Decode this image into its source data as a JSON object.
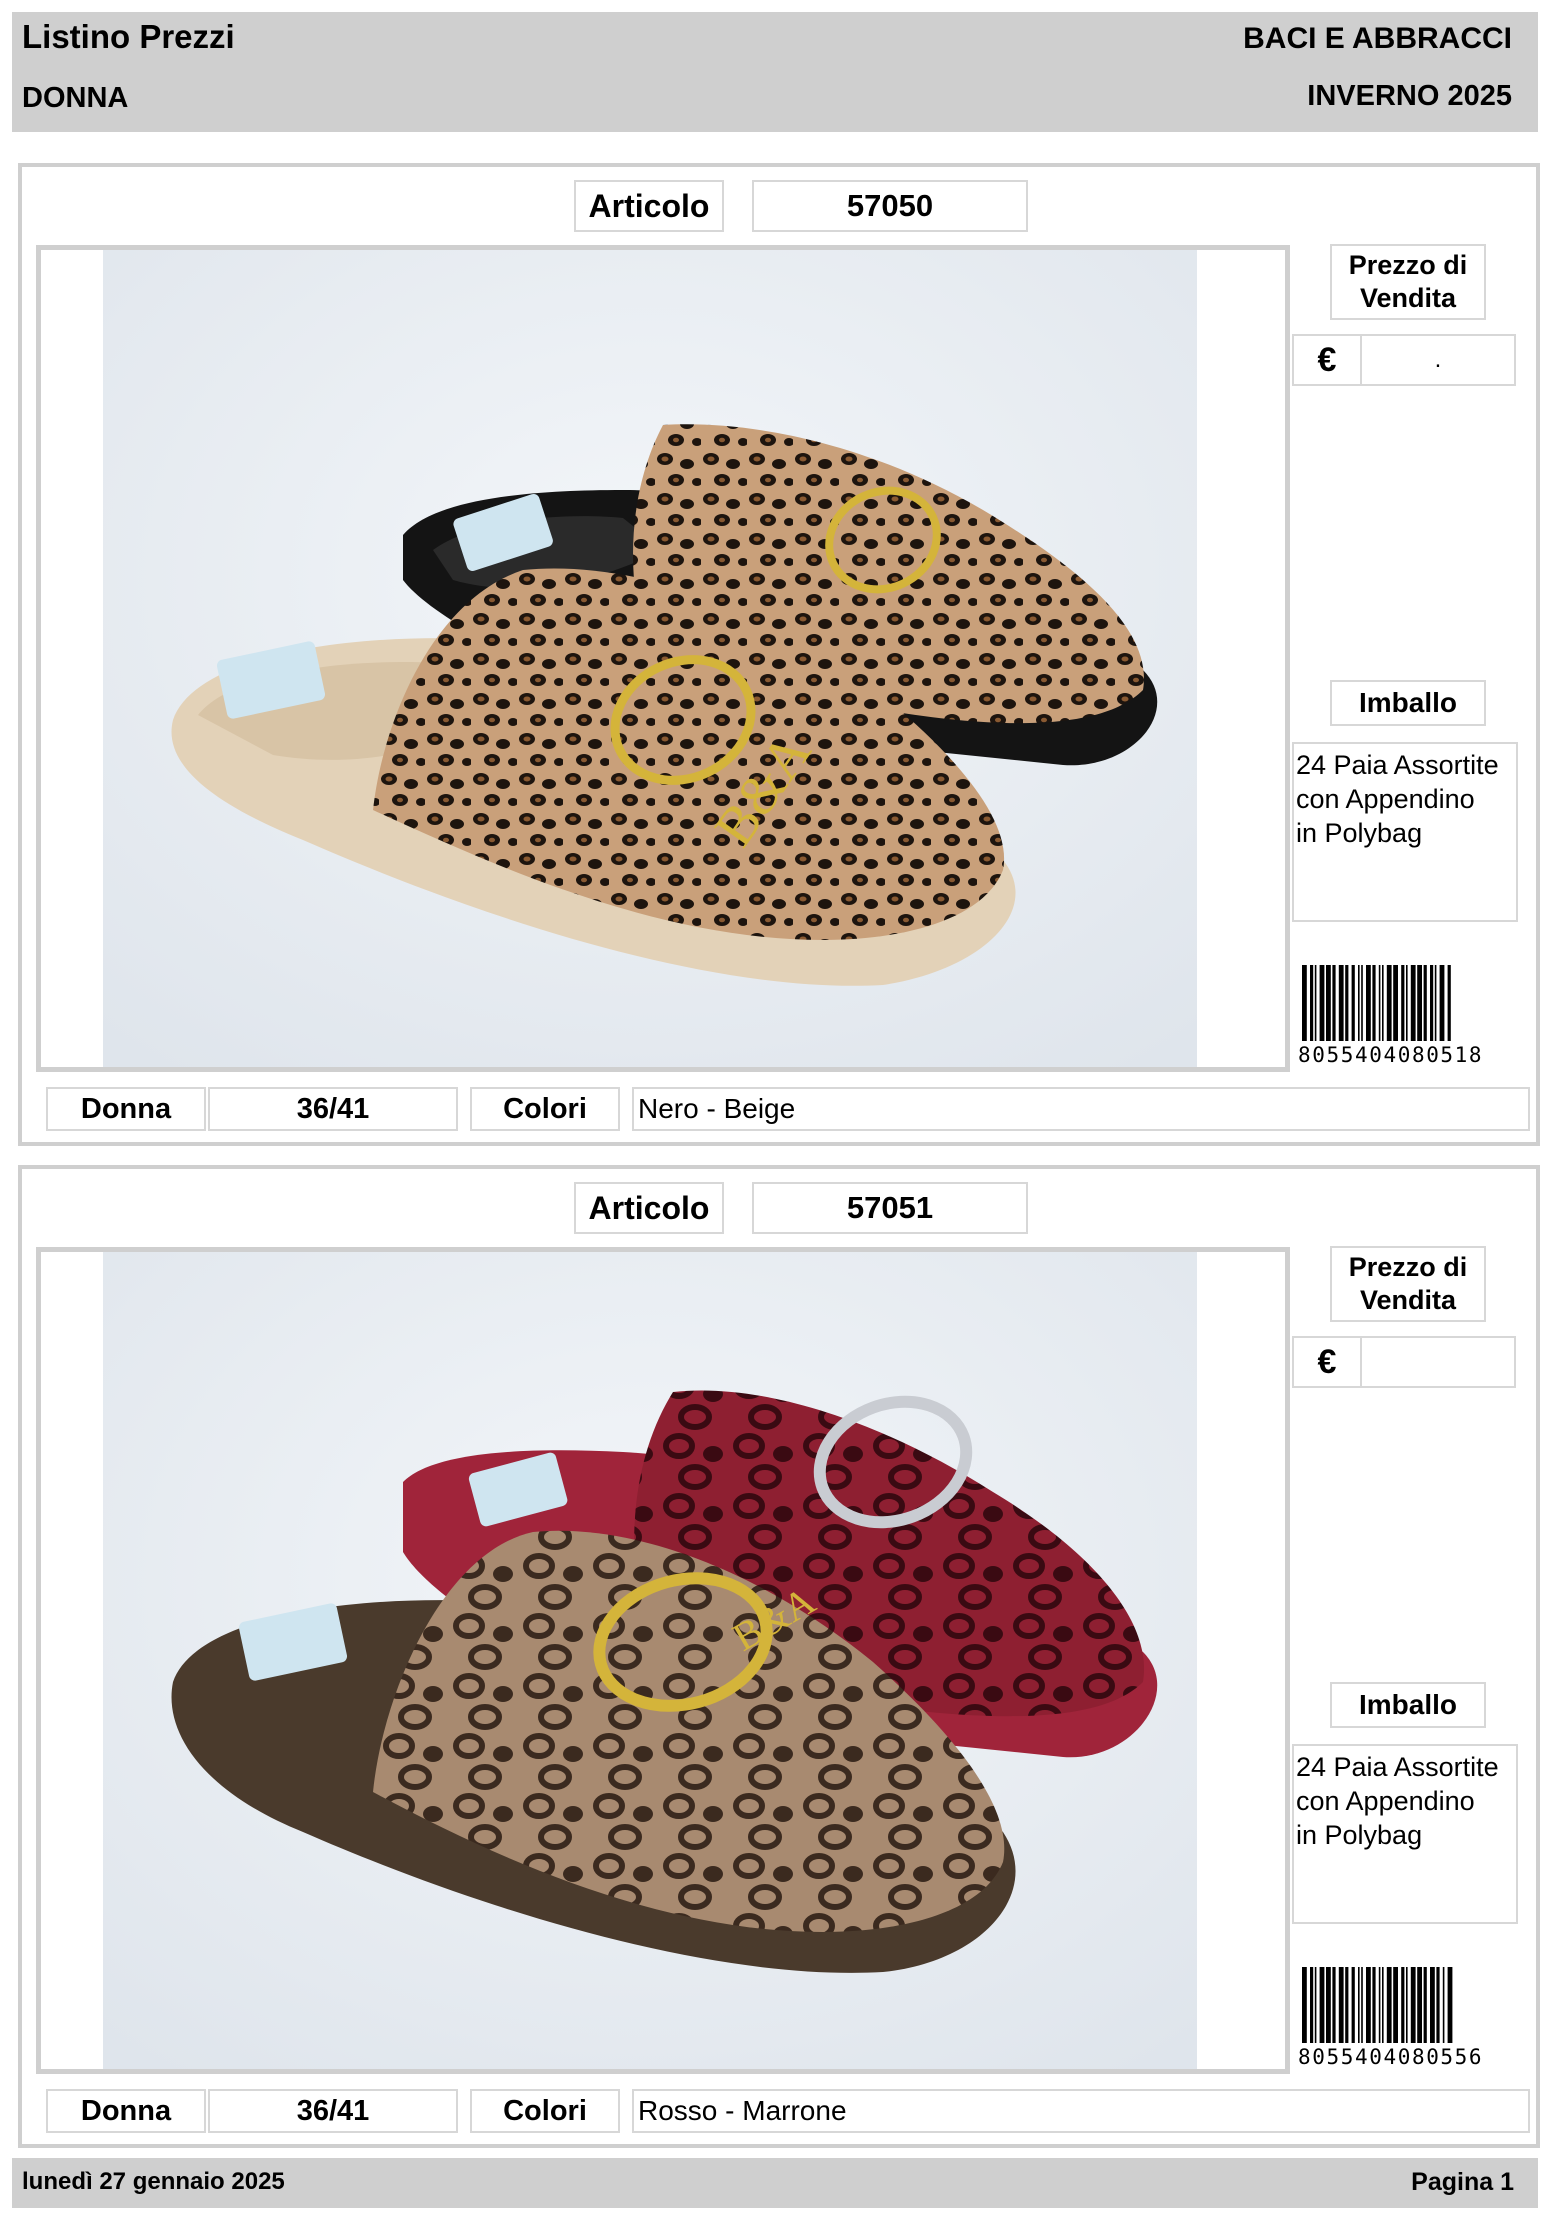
{
  "header": {
    "title": "Listino Prezzi",
    "category": "DONNA",
    "brand": "BACI E ABBRACCI",
    "season": "INVERNO 2025"
  },
  "products": [
    {
      "article_label": "Articolo",
      "article_code": "57050",
      "price_label_1": "Prezzo di",
      "price_label_2": "Vendita",
      "currency": "€",
      "price_value": ".",
      "packaging_label": "Imballo",
      "packaging_lines": [
        "24 Paia Assortite",
        "con Appendino",
        "in Polybag"
      ],
      "barcode": "8055404080518",
      "gender_label": "Donna",
      "sizes": "36/41",
      "colors_label": "Colori",
      "colors": "Nero - Beige",
      "photo_logo_text": "B&A"
    },
    {
      "article_label": "Articolo",
      "article_code": "57051",
      "price_label_1": "Prezzo di",
      "price_label_2": "Vendita",
      "currency": "€",
      "price_value": "",
      "packaging_label": "Imballo",
      "packaging_lines": [
        "24 Paia Assortite",
        "con Appendino",
        "in Polybag"
      ],
      "barcode": "8055404080556",
      "gender_label": "Donna",
      "sizes": "36/41",
      "colors_label": "Colori",
      "colors": "Rosso - Marrone",
      "photo_logo_text": "B&A"
    }
  ],
  "footer": {
    "date": "lunedì 27 gennaio 2025",
    "page": "Pagina 1"
  },
  "colors": {
    "band": "#cfcfcf",
    "card_border": "#cfcfcf",
    "box_border": "#d7d7d7"
  }
}
